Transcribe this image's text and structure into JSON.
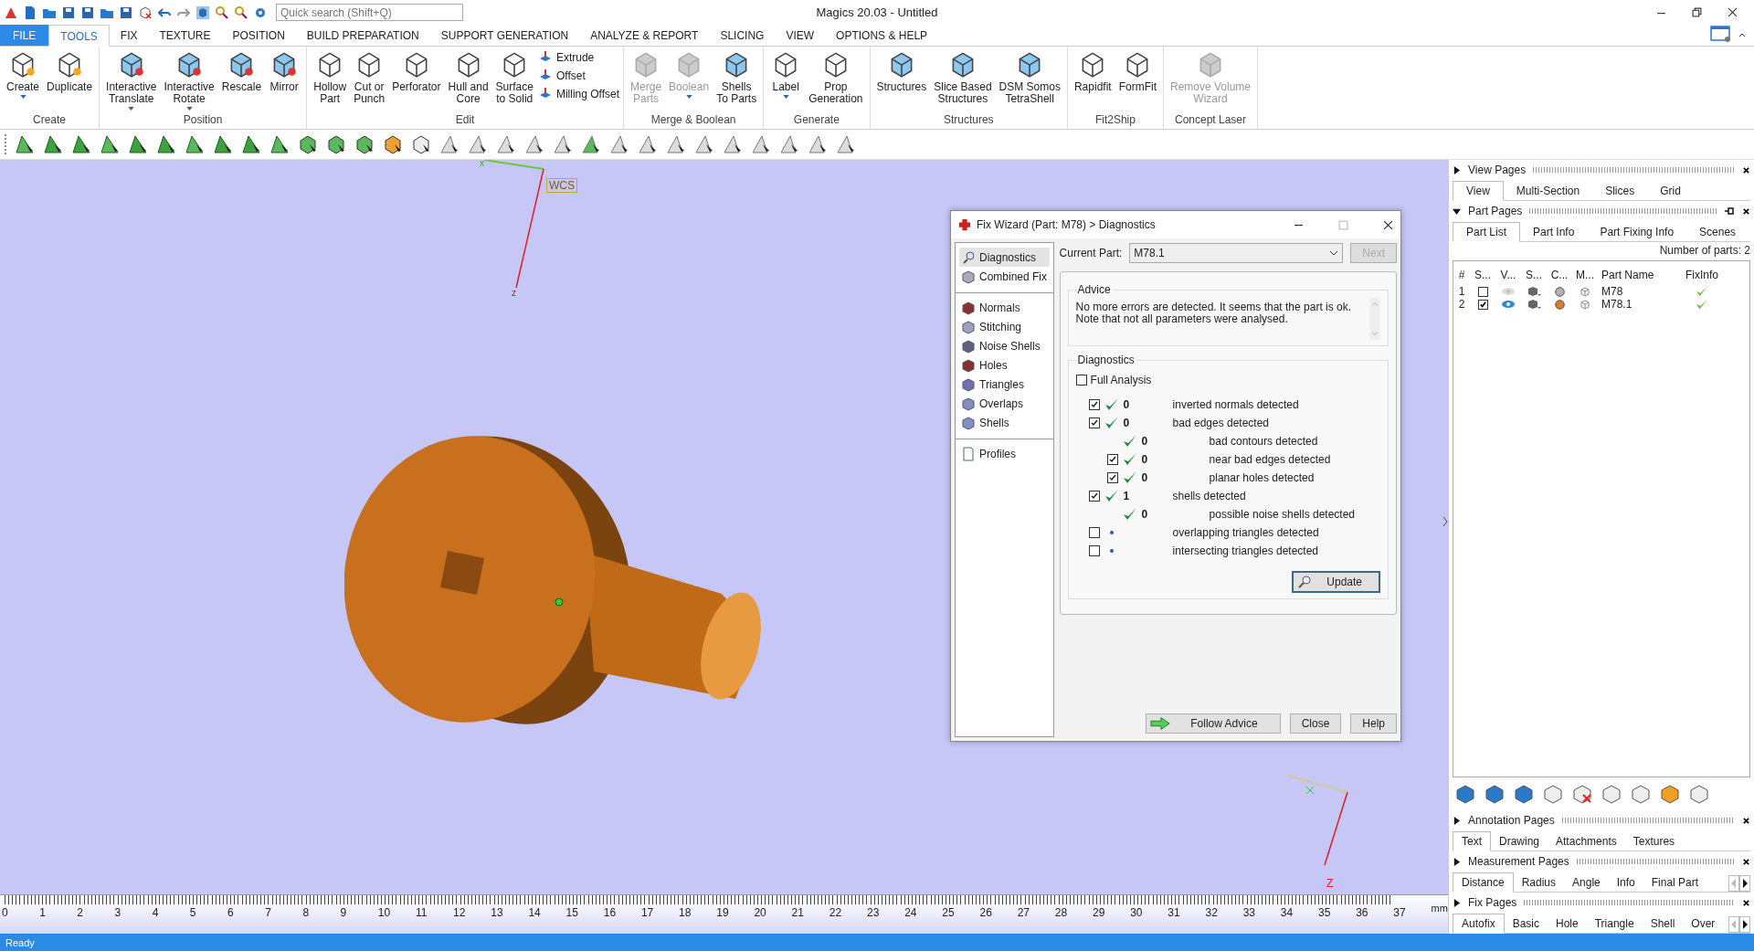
{
  "window": {
    "title": "Magics 20.03 - Untitled",
    "search_placeholder": "Quick search (Shift+Q)"
  },
  "menu_tabs": [
    {
      "label": "FILE",
      "kind": "file",
      "selected": false
    },
    {
      "label": "TOOLS",
      "kind": "tab",
      "selected": true
    },
    {
      "label": "FIX",
      "kind": "tab",
      "selected": false
    },
    {
      "label": "TEXTURE",
      "kind": "tab",
      "selected": false
    },
    {
      "label": "POSITION",
      "kind": "tab",
      "selected": false
    },
    {
      "label": "BUILD PREPARATION",
      "kind": "tab",
      "selected": false
    },
    {
      "label": "SUPPORT GENERATION",
      "kind": "tab",
      "selected": false
    },
    {
      "label": "ANALYZE & REPORT",
      "kind": "tab",
      "selected": false
    },
    {
      "label": "SLICING",
      "kind": "tab",
      "selected": false
    },
    {
      "label": "VIEW",
      "kind": "tab",
      "selected": false
    },
    {
      "label": "OPTIONS & HELP",
      "kind": "tab",
      "selected": false
    }
  ],
  "ribbon_groups": [
    {
      "label": "Create",
      "buttons": [
        {
          "kind": "large",
          "lines": [
            "Create"
          ],
          "dropdown": true,
          "disabled": false
        },
        {
          "kind": "large",
          "lines": [
            "Duplicate"
          ],
          "dropdown": false,
          "disabled": false
        }
      ]
    },
    {
      "label": "Position",
      "buttons": [
        {
          "kind": "large",
          "lines": [
            "Interactive",
            "Translate"
          ],
          "dropdown": true,
          "disabled": false
        },
        {
          "kind": "large",
          "lines": [
            "Interactive",
            "Rotate"
          ],
          "dropdown": true,
          "disabled": false
        },
        {
          "kind": "large",
          "lines": [
            "Rescale"
          ],
          "dropdown": false,
          "disabled": false
        },
        {
          "kind": "large",
          "lines": [
            "Mirror"
          ],
          "dropdown": false,
          "disabled": false
        }
      ]
    },
    {
      "label": "Edit",
      "buttons": [
        {
          "kind": "large",
          "lines": [
            "Hollow",
            "Part"
          ],
          "dropdown": false,
          "disabled": false
        },
        {
          "kind": "large",
          "lines": [
            "Cut or",
            "Punch"
          ],
          "dropdown": false,
          "disabled": false
        },
        {
          "kind": "large",
          "lines": [
            "Perforator"
          ],
          "dropdown": false,
          "disabled": false
        },
        {
          "kind": "large",
          "lines": [
            "Hull and",
            "Core"
          ],
          "dropdown": false,
          "disabled": false
        },
        {
          "kind": "large",
          "lines": [
            "Surface",
            "to Solid"
          ],
          "dropdown": false,
          "disabled": false
        },
        {
          "kind": "small",
          "lines": [
            "Extrude"
          ],
          "disabled": false
        },
        {
          "kind": "small",
          "lines": [
            "Offset"
          ],
          "disabled": false
        },
        {
          "kind": "small",
          "lines": [
            "Milling Offset"
          ],
          "disabled": false
        }
      ]
    },
    {
      "label": "Merge & Boolean",
      "buttons": [
        {
          "kind": "large",
          "lines": [
            "Merge",
            "Parts"
          ],
          "dropdown": false,
          "disabled": true
        },
        {
          "kind": "large",
          "lines": [
            "Boolean"
          ],
          "dropdown": true,
          "disabled": true
        },
        {
          "kind": "large",
          "lines": [
            "Shells",
            "To Parts"
          ],
          "dropdown": false,
          "disabled": false
        }
      ]
    },
    {
      "label": "Generate",
      "buttons": [
        {
          "kind": "large",
          "lines": [
            "Label"
          ],
          "dropdown": true,
          "disabled": false
        },
        {
          "kind": "large",
          "lines": [
            "Prop",
            "Generation"
          ],
          "dropdown": false,
          "disabled": false
        }
      ]
    },
    {
      "label": "Structures",
      "buttons": [
        {
          "kind": "large",
          "lines": [
            "Structures"
          ],
          "dropdown": false,
          "disabled": false
        },
        {
          "kind": "large",
          "lines": [
            "Slice Based",
            "Structures"
          ],
          "dropdown": false,
          "disabled": false
        },
        {
          "kind": "large",
          "lines": [
            "DSM Somos",
            "TetraShell"
          ],
          "dropdown": false,
          "disabled": false
        }
      ]
    },
    {
      "label": "Fit2Ship",
      "buttons": [
        {
          "kind": "large",
          "lines": [
            "Rapidfit"
          ],
          "dropdown": false,
          "disabled": false
        },
        {
          "kind": "large",
          "lines": [
            "FormFit"
          ],
          "dropdown": false,
          "disabled": false
        }
      ]
    },
    {
      "label": "Concept Laser",
      "buttons": [
        {
          "kind": "large",
          "lines": [
            "Remove Volume",
            "Wizard"
          ],
          "dropdown": false,
          "disabled": true
        }
      ]
    }
  ],
  "fix_wizard": {
    "title": "Fix Wizard (Part: M78) > Diagnostics",
    "nav": [
      {
        "items": [
          {
            "label": "Diagnostics",
            "selected": true
          },
          {
            "label": "Combined Fix",
            "selected": false
          }
        ]
      },
      {
        "items": [
          {
            "label": "Normals",
            "selected": false
          },
          {
            "label": "Stitching",
            "selected": false
          },
          {
            "label": "Noise Shells",
            "selected": false
          },
          {
            "label": "Holes",
            "selected": false
          },
          {
            "label": "Triangles",
            "selected": false
          },
          {
            "label": "Overlaps",
            "selected": false
          },
          {
            "label": "Shells",
            "selected": false
          }
        ]
      },
      {
        "items": [
          {
            "label": "Profiles",
            "selected": false
          }
        ]
      }
    ],
    "current_part_label": "Current Part:",
    "current_part": "M78.1",
    "next": {
      "label": "Next",
      "disabled": true
    },
    "advice_title": "Advice",
    "advice": [
      "No more errors are detected. It seems that the part is ok.",
      "Note that not all parameters were analysed."
    ],
    "diagnostics_title": "Diagnostics",
    "full_analysis": {
      "label": "Full Analysis",
      "checked": false
    },
    "checks": [
      {
        "kind": "check",
        "checked": true,
        "passed": true,
        "count": "0",
        "label": "inverted normals detected"
      },
      {
        "kind": "check",
        "checked": true,
        "passed": true,
        "count": "0",
        "label": "bad edges detected",
        "children": [
          {
            "kind": "plain",
            "passed": true,
            "count": "0",
            "label": "bad contours detected"
          },
          {
            "kind": "check",
            "checked": true,
            "passed": true,
            "count": "0",
            "label": "near bad edges detected"
          },
          {
            "kind": "check",
            "checked": true,
            "passed": true,
            "count": "0",
            "label": "planar holes detected"
          }
        ]
      },
      {
        "kind": "check",
        "checked": true,
        "passed": true,
        "count": "1",
        "label": "shells detected",
        "children": [
          {
            "kind": "plain",
            "passed": true,
            "count": "0",
            "label": "possible noise shells detected"
          }
        ]
      },
      {
        "kind": "check",
        "checked": false,
        "passed": false,
        "label": "overlapping triangles detected"
      },
      {
        "kind": "check",
        "checked": false,
        "passed": false,
        "label": "intersecting triangles detected"
      }
    ],
    "update": "Update",
    "follow_advice": "Follow Advice",
    "close": "Close",
    "help": "Help"
  },
  "ruler": {
    "labels": [
      "0",
      "1",
      "2",
      "3",
      "4",
      "5",
      "6",
      "7",
      "8",
      "9",
      "10",
      "11",
      "12",
      "13",
      "14",
      "15",
      "16",
      "17",
      "18",
      "19",
      "20",
      "21",
      "22",
      "23",
      "24",
      "25",
      "26",
      "27",
      "28",
      "29",
      "30",
      "31",
      "32",
      "33",
      "34",
      "35",
      "36",
      "37"
    ],
    "unit": "mm"
  },
  "axes": {
    "wcs": "WCS",
    "x": "x",
    "z": "z",
    "z2": "Z"
  },
  "view_pages": {
    "title": "View Pages",
    "expanded": false,
    "tabs": [
      {
        "label": "View",
        "selected": true
      },
      {
        "label": "Multi-Section",
        "selected": false
      },
      {
        "label": "Slices",
        "selected": false
      },
      {
        "label": "Grid",
        "selected": false
      }
    ]
  },
  "part_pages": {
    "title": "Part Pages",
    "expanded": true,
    "tabs": [
      {
        "label": "Part List",
        "selected": true
      },
      {
        "label": "Part Info",
        "selected": false
      },
      {
        "label": "Part Fixing Info",
        "selected": false
      },
      {
        "label": "Scenes",
        "selected": false
      }
    ],
    "part_count": "Number of parts: 2",
    "columns": [
      "#",
      "S...",
      "V...",
      "S...",
      "C...",
      "M...",
      "Part Name",
      "FixInfo"
    ],
    "rows": [
      {
        "index": "1",
        "checked": false,
        "visible": false,
        "color": "#b4b4b4",
        "name": "M78",
        "fixed": true
      },
      {
        "index": "2",
        "checked": true,
        "visible": true,
        "color": "#e07b28",
        "name": "M78.1",
        "fixed": true
      }
    ]
  },
  "lower_sections": [
    {
      "title": "Annotation Pages",
      "expanded": false,
      "scroll_arrows": false,
      "tabs": [
        {
          "label": "Text",
          "selected": true
        },
        {
          "label": "Drawing",
          "selected": false
        },
        {
          "label": "Attachments",
          "selected": false
        },
        {
          "label": "Textures",
          "selected": false
        }
      ]
    },
    {
      "title": "Measurement Pages",
      "expanded": false,
      "scroll_arrows": true,
      "tabs": [
        {
          "label": "Distance",
          "selected": true
        },
        {
          "label": "Radius",
          "selected": false
        },
        {
          "label": "Angle",
          "selected": false
        },
        {
          "label": "Info",
          "selected": false
        },
        {
          "label": "Final Part",
          "selected": false
        }
      ]
    },
    {
      "title": "Fix Pages",
      "expanded": false,
      "scroll_arrows": true,
      "tabs": [
        {
          "label": "Autofix",
          "selected": true
        },
        {
          "label": "Basic",
          "selected": false
        },
        {
          "label": "Hole",
          "selected": false
        },
        {
          "label": "Triangle",
          "selected": false
        },
        {
          "label": "Shell",
          "selected": false
        },
        {
          "label": "Over",
          "selected": false
        }
      ]
    }
  ],
  "status_bar": {
    "text": "Ready"
  }
}
